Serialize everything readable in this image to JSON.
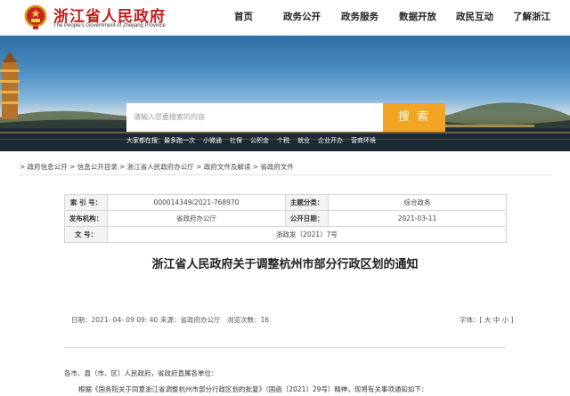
{
  "header": {
    "logo_cn": "浙江省人民政府",
    "logo_en": "The People's Government of Zhejiang Province",
    "nav": [
      "首页",
      "政务公开",
      "政务服务",
      "数据开放",
      "政民互动",
      "了解浙江"
    ]
  },
  "search": {
    "placeholder": "请输入您要搜索的内容",
    "button": "搜 索",
    "hot_label": "大家都在搜：",
    "hot_words": [
      "最多跑一次",
      "小微通",
      "社保",
      "公积金",
      "个税",
      "就业",
      "企业开办",
      "营商环境"
    ]
  },
  "breadcrumb": "> 政府信息公开 > 信息公开目录 > 浙江省人民政府办公厅 > 政府文件及解读 > 省政府文件",
  "meta": {
    "index_label": "索 引 号：",
    "index_value": "000014349/2021-768970",
    "category_label": "主题分类：",
    "category_value": "综合政务",
    "publisher_label": "发布机构：",
    "publisher_value": "省政府办公厅",
    "date_label": "公开日期：",
    "date_value": "2021-03-11",
    "docno_label": "文   号：",
    "docno_value": "浙政发〔2021〕7号"
  },
  "title": "浙江省人民政府关于调整杭州市部分行政区划的通知",
  "info": {
    "date": "日期：2021- 04- 09 09: 40",
    "source": "来源：省政府办公厅",
    "views": "浏览次数：16",
    "font_size": "字体：[ 大  中  小 ]"
  },
  "body": {
    "salutation": "各市、县（市、区）人民政府，省政府直属各单位：",
    "para1": "根据《国务院关于同意浙江省调整杭州市部分行政区划的批复》（国函〔2021〕29号）精神，现将有关事项通知如下："
  },
  "colors": {
    "brand_red": "#c0201f",
    "search_orange": "#f4a425"
  }
}
